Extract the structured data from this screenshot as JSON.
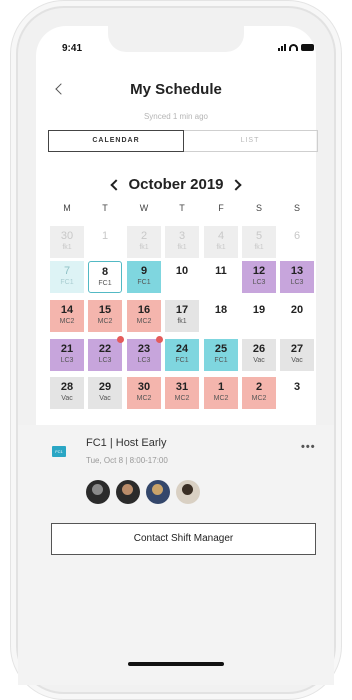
{
  "status_bar": {
    "time": "9:41"
  },
  "header": {
    "title": "My Schedule",
    "subtitle": "Synced 1 min ago"
  },
  "tabs": [
    {
      "label": "CALENDAR",
      "active": true
    },
    {
      "label": "LIST",
      "active": false
    }
  ],
  "calendar": {
    "month_label": "October 2019",
    "weekdays": [
      "M",
      "T",
      "W",
      "T",
      "F",
      "S",
      "S"
    ],
    "weeks": [
      [
        {
          "day": "30",
          "code": "fk1",
          "style": "muted",
          "color": "#eeeeee"
        },
        {
          "day": "1",
          "code": "",
          "style": "muted",
          "color": ""
        },
        {
          "day": "2",
          "code": "fk1",
          "style": "muted",
          "color": "#eeeeee"
        },
        {
          "day": "3",
          "code": "fk1",
          "style": "muted",
          "color": "#eeeeee"
        },
        {
          "day": "4",
          "code": "fk1",
          "style": "muted",
          "color": "#eeeeee"
        },
        {
          "day": "5",
          "code": "fk1",
          "style": "muted",
          "color": "#eeeeee"
        },
        {
          "day": "6",
          "code": "",
          "style": "muted",
          "color": ""
        }
      ],
      [
        {
          "day": "7",
          "code": "FC1",
          "style": "faded",
          "color": "#ddf3f5"
        },
        {
          "day": "8",
          "code": "FC1",
          "style": "today",
          "color": "#ffffff"
        },
        {
          "day": "9",
          "code": "FC1",
          "style": "normal",
          "color": "#7fd6df"
        },
        {
          "day": "10",
          "code": "",
          "style": "normal",
          "color": ""
        },
        {
          "day": "11",
          "code": "",
          "style": "normal",
          "color": ""
        },
        {
          "day": "12",
          "code": "LC3",
          "style": "normal",
          "color": "#c7a5dc"
        },
        {
          "day": "13",
          "code": "LC3",
          "style": "normal",
          "color": "#c7a5dc"
        }
      ],
      [
        {
          "day": "14",
          "code": "MC2",
          "style": "normal",
          "color": "#f4b5ad"
        },
        {
          "day": "15",
          "code": "MC2",
          "style": "normal",
          "color": "#f4b5ad"
        },
        {
          "day": "16",
          "code": "MC2",
          "style": "normal",
          "color": "#f4b5ad"
        },
        {
          "day": "17",
          "code": "fk1",
          "style": "normal",
          "color": "#e4e4e4"
        },
        {
          "day": "18",
          "code": "",
          "style": "normal",
          "color": ""
        },
        {
          "day": "19",
          "code": "",
          "style": "normal",
          "color": ""
        },
        {
          "day": "20",
          "code": "",
          "style": "normal",
          "color": ""
        }
      ],
      [
        {
          "day": "21",
          "code": "LC3",
          "style": "normal",
          "color": "#c7a5dc"
        },
        {
          "day": "22",
          "code": "LC3",
          "style": "normal",
          "color": "#c7a5dc",
          "alert": true
        },
        {
          "day": "23",
          "code": "LC3",
          "style": "normal",
          "color": "#c7a5dc",
          "alert": true
        },
        {
          "day": "24",
          "code": "FC1",
          "style": "normal",
          "color": "#7fd6df"
        },
        {
          "day": "25",
          "code": "FC1",
          "style": "normal",
          "color": "#7fd6df"
        },
        {
          "day": "26",
          "code": "Vac",
          "style": "normal",
          "color": "#e4e4e4"
        },
        {
          "day": "27",
          "code": "Vac",
          "style": "normal",
          "color": "#e4e4e4"
        }
      ],
      [
        {
          "day": "28",
          "code": "Vac",
          "style": "normal",
          "color": "#e4e4e4"
        },
        {
          "day": "29",
          "code": "Vac",
          "style": "normal",
          "color": "#e4e4e4"
        },
        {
          "day": "30",
          "code": "MC2",
          "style": "normal",
          "color": "#f4b5ad"
        },
        {
          "day": "31",
          "code": "MC2",
          "style": "normal",
          "color": "#f4b5ad"
        },
        {
          "day": "1",
          "code": "MC2",
          "style": "normal",
          "color": "#f4b5ad"
        },
        {
          "day": "2",
          "code": "MC2",
          "style": "normal",
          "color": "#f4b5ad"
        },
        {
          "day": "3",
          "code": "",
          "style": "normal",
          "color": ""
        }
      ]
    ]
  },
  "shift": {
    "badge": "FC1",
    "title": "FC1 | Host Early",
    "time": "Tue, Oct 8 | 8:00-17:00",
    "more": "•••"
  },
  "contact_button": "Contact Shift Manager"
}
